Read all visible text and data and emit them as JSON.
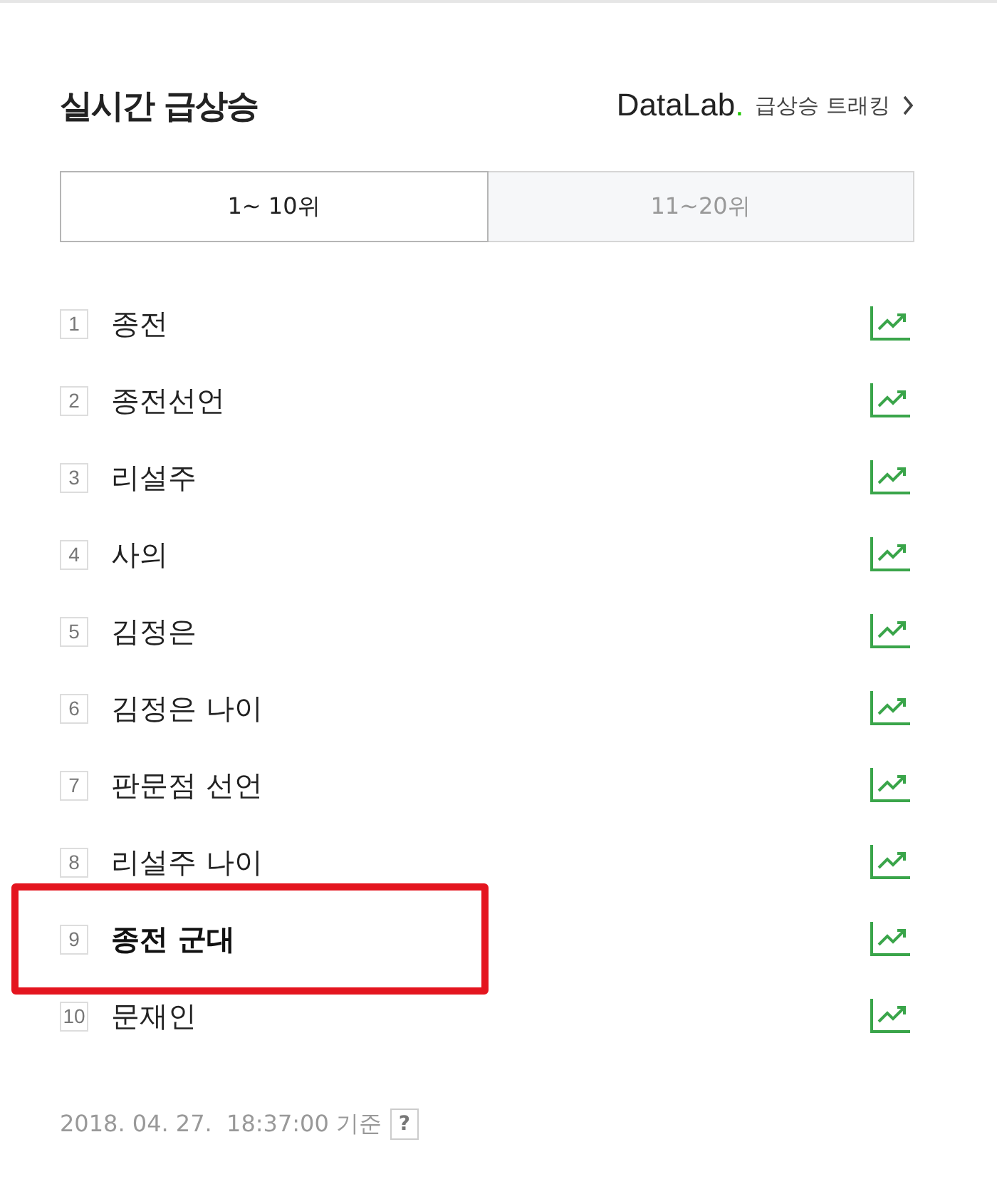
{
  "header": {
    "title": "실시간 급상승",
    "brand": "DataLab",
    "brand_dot": ".",
    "link": "급상승 트래킹"
  },
  "tabs": [
    {
      "label": "1~ 10위",
      "selected": true
    },
    {
      "label": "11~20위",
      "selected": false
    }
  ],
  "items": [
    {
      "rank": "1",
      "keyword": "종전",
      "highlighted": false
    },
    {
      "rank": "2",
      "keyword": "종전선언",
      "highlighted": false
    },
    {
      "rank": "3",
      "keyword": "리설주",
      "highlighted": false
    },
    {
      "rank": "4",
      "keyword": "사의",
      "highlighted": false
    },
    {
      "rank": "5",
      "keyword": "김정은",
      "highlighted": false
    },
    {
      "rank": "6",
      "keyword": "김정은 나이",
      "highlighted": false
    },
    {
      "rank": "7",
      "keyword": "판문점 선언",
      "highlighted": false
    },
    {
      "rank": "8",
      "keyword": "리설주 나이",
      "highlighted": false
    },
    {
      "rank": "9",
      "keyword": "종전 군대",
      "highlighted": true
    },
    {
      "rank": "10",
      "keyword": "문재인",
      "highlighted": false
    }
  ],
  "footer": {
    "timestamp": "2018. 04. 27.  18:37:00 기준",
    "help": "?"
  }
}
